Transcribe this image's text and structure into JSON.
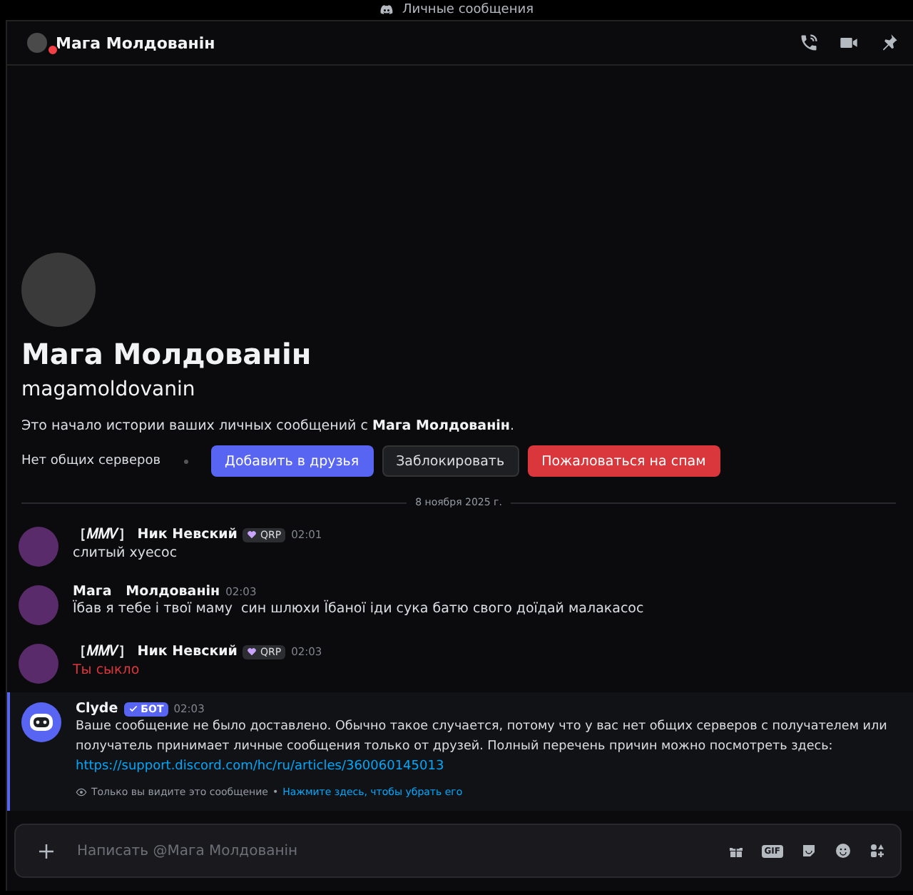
{
  "window": {
    "title": "Личные сообщения"
  },
  "header": {
    "name": "Мага Молдованін",
    "do_not_disturb": true
  },
  "intro": {
    "name": "Мага Молдованін",
    "username": "magamoldovanin",
    "text": "Это начало истории ваших личных сообщений с **Мага Молдованін**.",
    "mutual": "Нет общих серверов",
    "buttons": [
      {
        "label": "Добавить в друзья",
        "kind": "primary"
      },
      {
        "label": "Заблокировать",
        "kind": "secondary"
      },
      {
        "label": "Пожаловаться на спам",
        "kind": "danger"
      }
    ]
  },
  "date_divider": "8 ноября 2025 г.",
  "messages": [
    {
      "kind": "user",
      "author": "［𝑀𝑀𝑉］ Ник Невский",
      "tag": "QRP",
      "time": "02:01",
      "text": "слитый хуесос",
      "failed": false
    },
    {
      "kind": "user",
      "author": "Мага   Молдованін",
      "time": "02:03",
      "text": "Їбав я тебе і твої маму  син шлюхи Їбаної іди сука батю свого доїдай малакасос",
      "failed": false
    },
    {
      "kind": "user",
      "author": "［𝑀𝑀𝑉］ Ник Невский",
      "tag": "QRP",
      "time": "02:03",
      "text": "Ты сыкло",
      "failed": true
    },
    {
      "kind": "bot",
      "author": "Clyde",
      "tag": "БОТ",
      "time": "02:03",
      "text": "Ваше сообщение не было доставлено. Обычно такое случается, потому что у вас нет общих серверов с получателем или получатель принимает личные сообщения только от друзей. Полный перечень причин можно посмотреть здесь:",
      "link": "https://support.discord.com/hc/ru/articles/360060145013",
      "note": "Только вы видите это сообщение",
      "note_sep": "•",
      "dismiss": "Нажмите здесь, чтобы убрать его"
    }
  ],
  "composer": {
    "placeholder": "Написать @Мага Молдованін",
    "gif_label": "GIF"
  }
}
